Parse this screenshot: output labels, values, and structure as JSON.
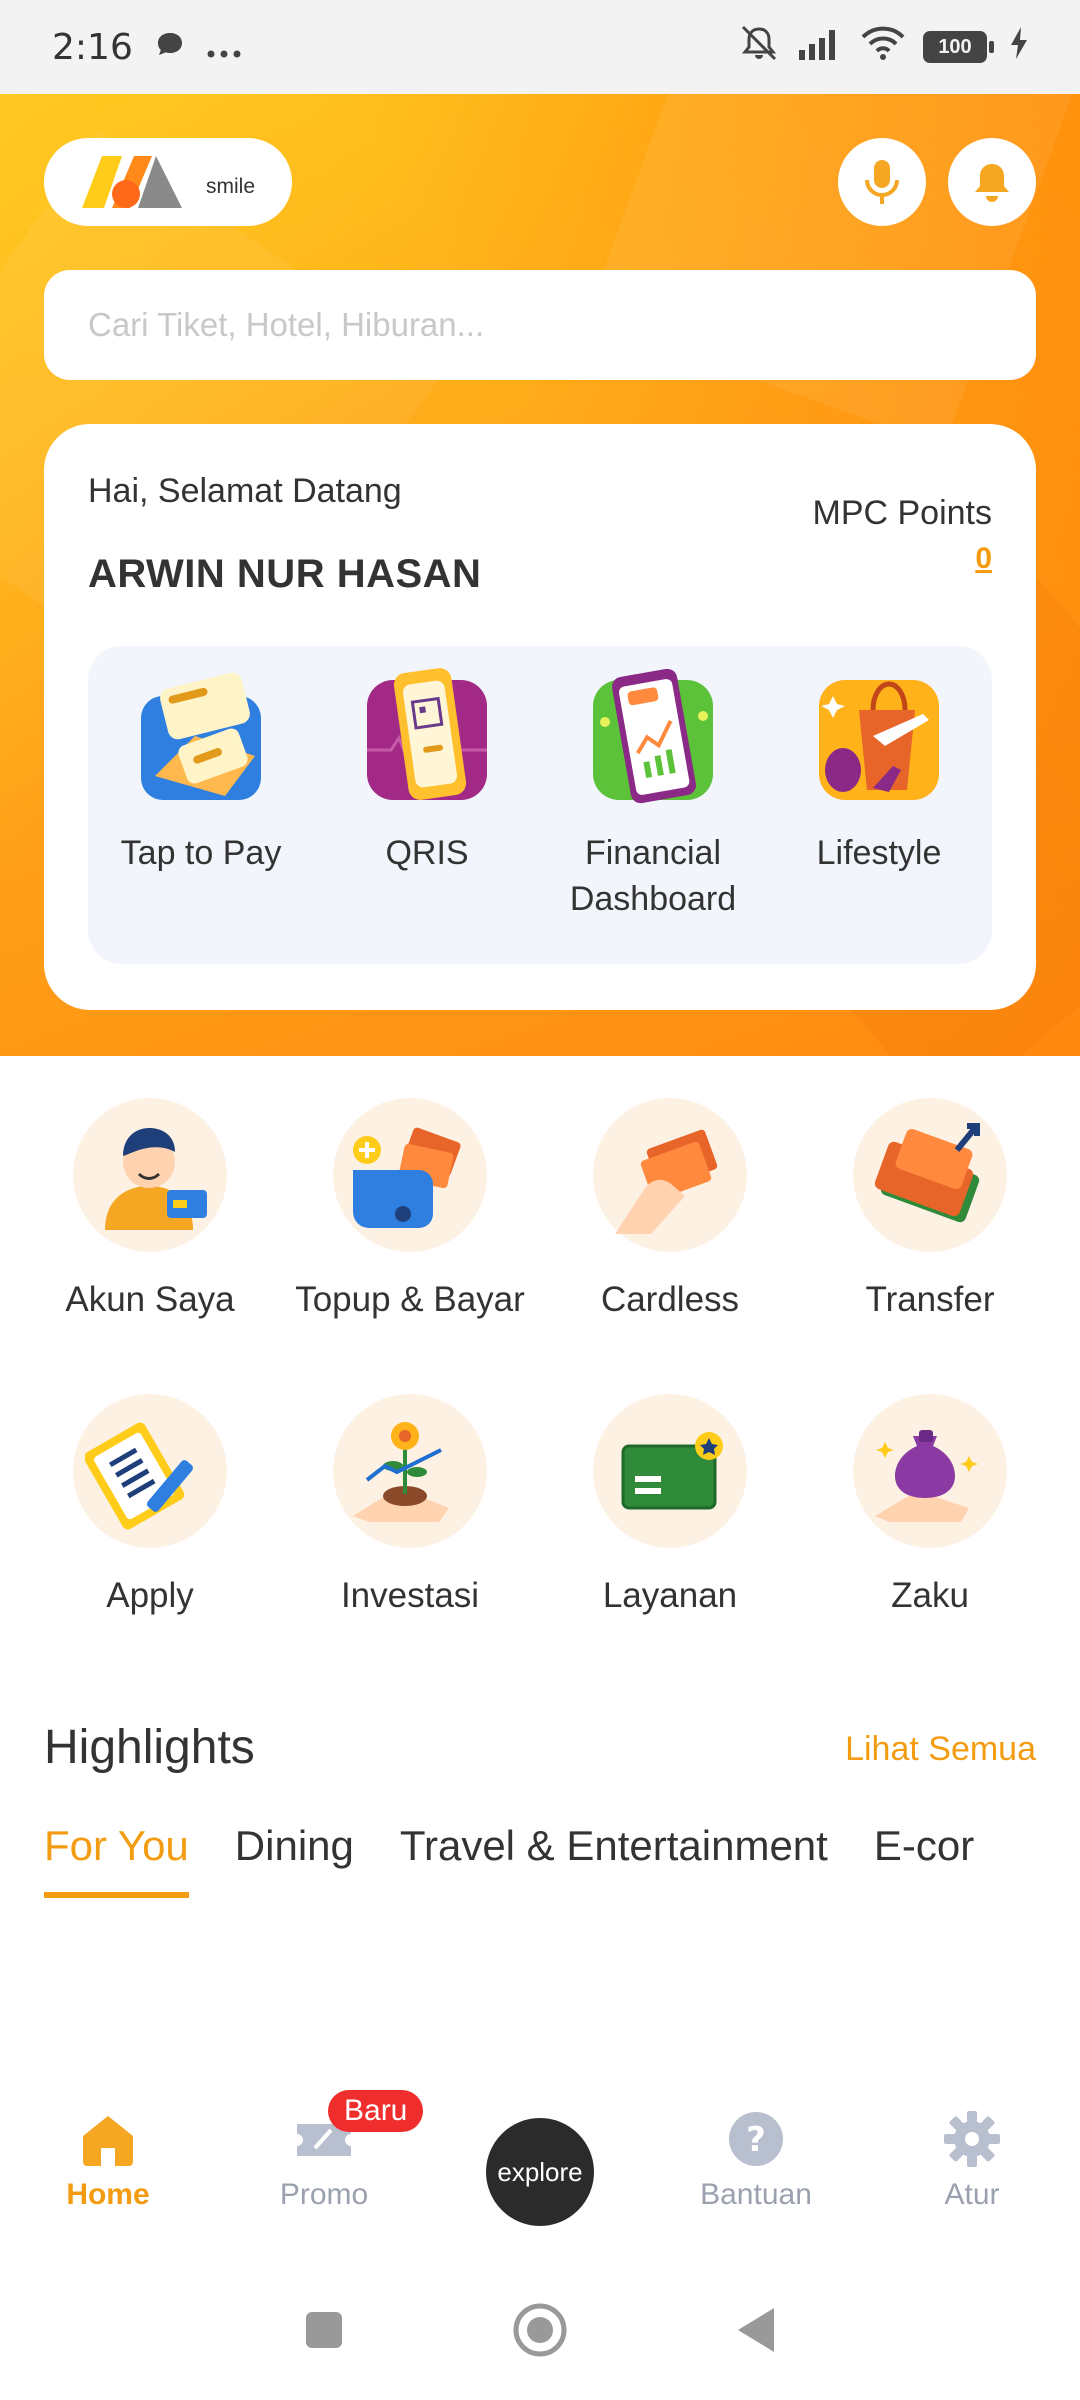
{
  "status_bar": {
    "time": "2:16",
    "battery": "100"
  },
  "header": {
    "logo_text": "smile",
    "search_placeholder": "Cari Tiket, Hotel, Hiburan..."
  },
  "welcome": {
    "greeting": "Hai, Selamat Datang",
    "name": "ARWIN NUR HASAN",
    "points_label": "MPC Points",
    "points_value": "0"
  },
  "features": [
    {
      "label": "Tap to Pay",
      "icon": "tap-to-pay-icon"
    },
    {
      "label": "QRIS",
      "icon": "qris-icon"
    },
    {
      "label": "Financial Dashboard",
      "icon": "financial-dashboard-icon"
    },
    {
      "label": "Lifestyle",
      "icon": "lifestyle-icon"
    }
  ],
  "menu": [
    {
      "label": "Akun Saya",
      "icon": "account-icon"
    },
    {
      "label": "Topup & Bayar",
      "icon": "wallet-icon"
    },
    {
      "label": "Cardless",
      "icon": "cardless-icon"
    },
    {
      "label": "Transfer",
      "icon": "transfer-icon"
    },
    {
      "label": "Apply",
      "icon": "clipboard-icon"
    },
    {
      "label": "Investasi",
      "icon": "investment-icon"
    },
    {
      "label": "Layanan",
      "icon": "card-service-icon"
    },
    {
      "label": "Zaku",
      "icon": "money-bag-icon"
    }
  ],
  "highlights": {
    "title": "Highlights",
    "see_all": "Lihat Semua",
    "tabs": [
      "For You",
      "Dining",
      "Travel & Entertainment",
      "E-cor"
    ]
  },
  "bottom_nav": {
    "home": "Home",
    "promo": "Promo",
    "promo_badge": "Baru",
    "explore": "explore",
    "help": "Bantuan",
    "settings": "Atur"
  },
  "colors": {
    "accent": "#f39c12",
    "hero_start": "#ffc21a",
    "hero_end": "#ff8a10"
  }
}
